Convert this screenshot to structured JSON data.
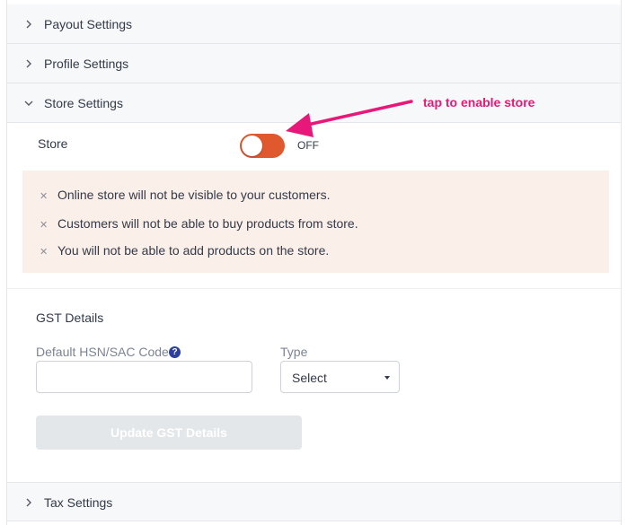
{
  "accordion": {
    "payout": "Payout Settings",
    "profile": "Profile Settings",
    "store": "Store Settings",
    "tax": "Tax Settings"
  },
  "store": {
    "label": "Store",
    "toggle_state": "OFF",
    "toggle_on": false,
    "toggle_color": "#e0582e"
  },
  "info": {
    "background": "#fbefea",
    "items": [
      "Online store will not be visible to your customers.",
      "Customers will not be able to buy products from store.",
      "You will not be able to add products on the store."
    ]
  },
  "gst": {
    "title": "GST Details",
    "hsn_label": "Default HSN/SAC Code",
    "hsn_value": "",
    "type_label": "Type",
    "type_selected": "Select",
    "update_label": "Update GST Details"
  },
  "annotation": {
    "text": "tap to enable store",
    "color": "#e8177a"
  }
}
